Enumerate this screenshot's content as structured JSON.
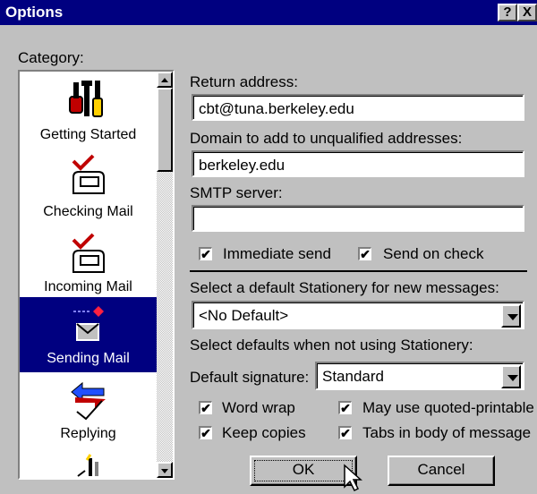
{
  "window": {
    "title": "Options",
    "help_label": "?",
    "close_label": "X"
  },
  "category": {
    "label": "Category:",
    "items": [
      {
        "label": "Getting Started",
        "icon": "tools-icon"
      },
      {
        "label": "Checking Mail",
        "icon": "mailbox-icon"
      },
      {
        "label": "Incoming Mail",
        "icon": "mailbox-icon"
      },
      {
        "label": "Sending Mail",
        "icon": "sending-mail-icon",
        "selected": true
      },
      {
        "label": "Replying",
        "icon": "reply-arrows-icon"
      },
      {
        "label": "",
        "icon": "partial-icon"
      }
    ]
  },
  "form": {
    "return_address_label": "Return address:",
    "return_address_value": "cbt@tuna.berkeley.edu",
    "domain_label": "Domain to add to unqualified addresses:",
    "domain_value": "berkeley.edu",
    "smtp_label": "SMTP server:",
    "smtp_value": "",
    "immediate_send": {
      "label": "Immediate send",
      "checked": true
    },
    "send_on_check": {
      "label": "Send on check",
      "checked": true
    },
    "stationery_label": "Select a default Stationery for new messages:",
    "stationery_value": "<No Default>",
    "defaults_label": "Select defaults when not using Stationery:",
    "signature_label": "Default signature:",
    "signature_value": "Standard",
    "word_wrap": {
      "label": "Word wrap",
      "checked": true
    },
    "quoted_printable": {
      "label": "May use quoted-printable",
      "checked": true
    },
    "keep_copies": {
      "label": "Keep copies",
      "checked": true
    },
    "tabs_in_body": {
      "label": "Tabs in body of message",
      "checked": true
    }
  },
  "buttons": {
    "ok": "OK",
    "cancel": "Cancel"
  },
  "check_mark": "✔"
}
